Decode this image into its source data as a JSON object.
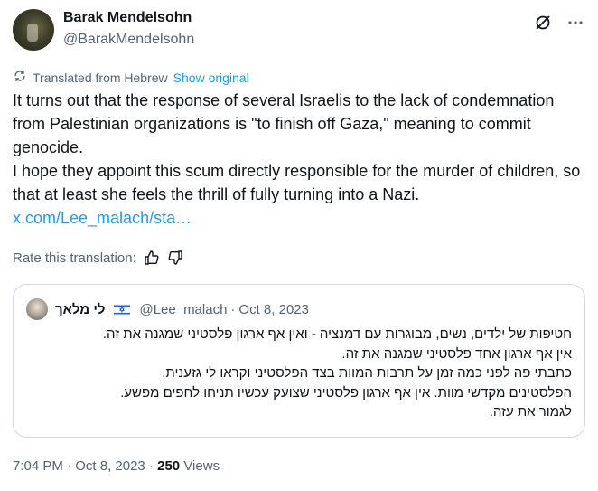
{
  "author": {
    "name": "Barak Mendelsohn",
    "handle": "@BarakMendelsohn"
  },
  "translation": {
    "label": "Translated from Hebrew",
    "show_original": "Show original"
  },
  "tweet": {
    "lines": [
      "It turns out that the response of several Israelis to the lack of condemnation from Palestinian organizations is \"to finish off Gaza,\" meaning to commit genocide.",
      "I hope they appoint this scum directly responsible for the murder of children, so that at least she feels the thrill of fully turning into a Nazi."
    ],
    "url": "x.com/Lee_malach/sta…"
  },
  "rate": {
    "label": "Rate this translation:"
  },
  "quote": {
    "name": "לי מלאך",
    "handle": "@Lee_malach",
    "separator": "·",
    "date": "Oct 8, 2023",
    "lines": [
      "חטיפות של ילדים, נשים, מבוגרות עם דמנציה - ואין אף ארגון פלסטיני שמגנה את זה.",
      "אין אף ארגון אחד פלסטיני שמגנה את זה.",
      "כתבתי פה לפני כמה זמן על תרבות המוות בצד הפלסטיני וקראו לי גזענית.",
      "הפלסטינים מקדשי מוות. אין אף ארגון פלסטיני שצועק עכשיו תניחו לחפים מפשע.",
      "לגמור את עזה."
    ]
  },
  "footer": {
    "time": "7:04 PM",
    "separator": "·",
    "date": "Oct 8, 2023",
    "views_count": "250",
    "views_label": "Views"
  },
  "icons": {
    "grok": "grok-icon",
    "more": "more-icon",
    "translate": "translate-icon",
    "thumbs_up": "thumbs-up-icon",
    "thumbs_down": "thumbs-down-icon",
    "flag": "israel-flag-icon"
  }
}
